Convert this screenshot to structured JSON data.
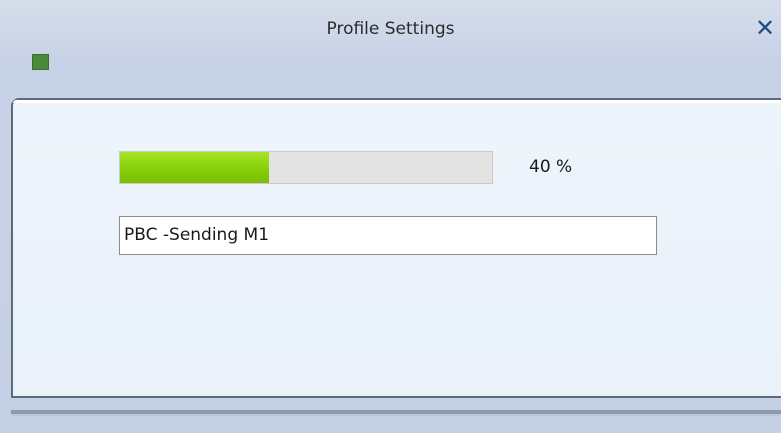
{
  "window": {
    "title": "Profile Settings",
    "close_glyph": "✕"
  },
  "progress": {
    "value": 0.4,
    "label": "40 %"
  },
  "status": {
    "text": "PBC -Sending M1"
  },
  "colors": {
    "progress_fill": "#86cf0a",
    "progress_track": "#e3e3e3",
    "app_icon": "#4a8a3a",
    "close": "#1d4f86"
  },
  "icons": {
    "app": "app-icon",
    "close": "close-icon"
  }
}
